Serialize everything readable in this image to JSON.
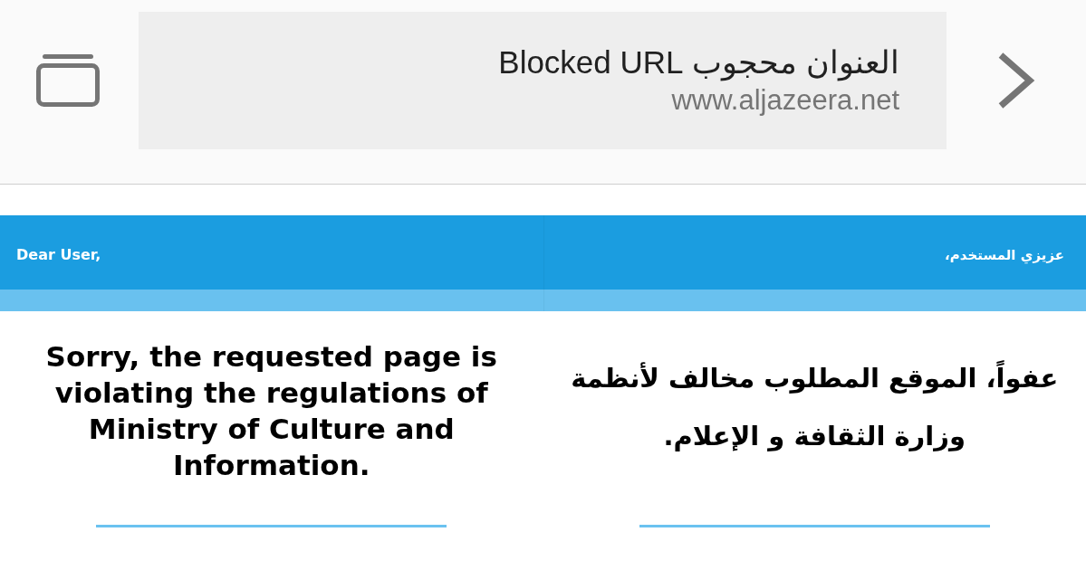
{
  "address_bar": {
    "title": "العنوان محجوب Blocked URL",
    "url": "www.aljazeera.net"
  },
  "header": {
    "greetings": [
      {
        "kind": "arabic",
        "text": "عزيزي المستخدم،"
      },
      {
        "kind": "english",
        "text": "Dear User,"
      }
    ]
  },
  "messages": [
    {
      "kind": "arabic",
      "text": "عفواً، الموقع المطلوب مخالف لأنظمة وزارة الثقافة و الإعلام."
    },
    {
      "kind": "english",
      "text": "Sorry, the requested page is violating the regulations of Ministry of Culture and Information."
    }
  ]
}
